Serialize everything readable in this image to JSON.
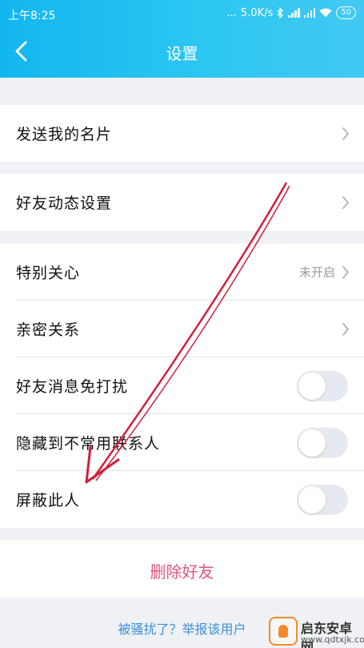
{
  "status_bar": {
    "time": "上午8:25",
    "network_speed": "5.0K/s",
    "bluetooth_icon": "bluetooth-icon",
    "signal_icon": "signal-icon",
    "wifi_icon": "wifi-icon",
    "battery": "50"
  },
  "navbar": {
    "back_icon": "chevron-left-icon",
    "title": "设置"
  },
  "groups": [
    {
      "items": [
        {
          "label": "发送我的名片",
          "control": "chevron"
        }
      ]
    },
    {
      "items": [
        {
          "label": "好友动态设置",
          "control": "chevron"
        }
      ]
    },
    {
      "items": [
        {
          "label": "特别关心",
          "value": "未开启",
          "control": "chevron"
        },
        {
          "label": "亲密关系",
          "control": "chevron"
        },
        {
          "label": "好友消息免打扰",
          "control": "toggle",
          "toggle_on": false
        },
        {
          "label": "隐藏到不常用联系人",
          "control": "toggle",
          "toggle_on": false
        },
        {
          "label": "屏蔽此人",
          "control": "toggle",
          "toggle_on": false
        }
      ]
    }
  ],
  "delete_button": {
    "label": "删除好友"
  },
  "report_link": {
    "label": "被骚扰了？举报该用户"
  },
  "annotation": {
    "arrow_color": "#d11f3b"
  },
  "watermark": {
    "title": "启东安卓网",
    "url": "www.qdtxjk.com"
  },
  "colors": {
    "header_start": "#12b6ef",
    "header_end": "#42c9f3",
    "delete_text": "#e0547f",
    "link_text": "#3a8fd8"
  }
}
